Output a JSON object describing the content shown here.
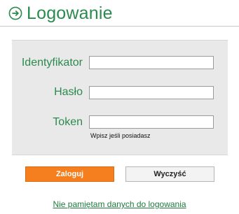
{
  "header": {
    "title": "Logowanie",
    "icon": "arrow-right-circle-icon",
    "accent_color": "#2b8a4e"
  },
  "form": {
    "identifier_label": "Identyfikator",
    "identifier_value": "",
    "password_label": "Hasło",
    "password_value": "",
    "token_label": "Token",
    "token_value": "",
    "token_hint": "Wpisz jeśli posiadasz"
  },
  "actions": {
    "login_label": "Zaloguj",
    "login_color": "#f57f1f",
    "clear_label": "Wyczyść"
  },
  "footer": {
    "forgot_link": "Nie pamiętam danych do logowania"
  }
}
